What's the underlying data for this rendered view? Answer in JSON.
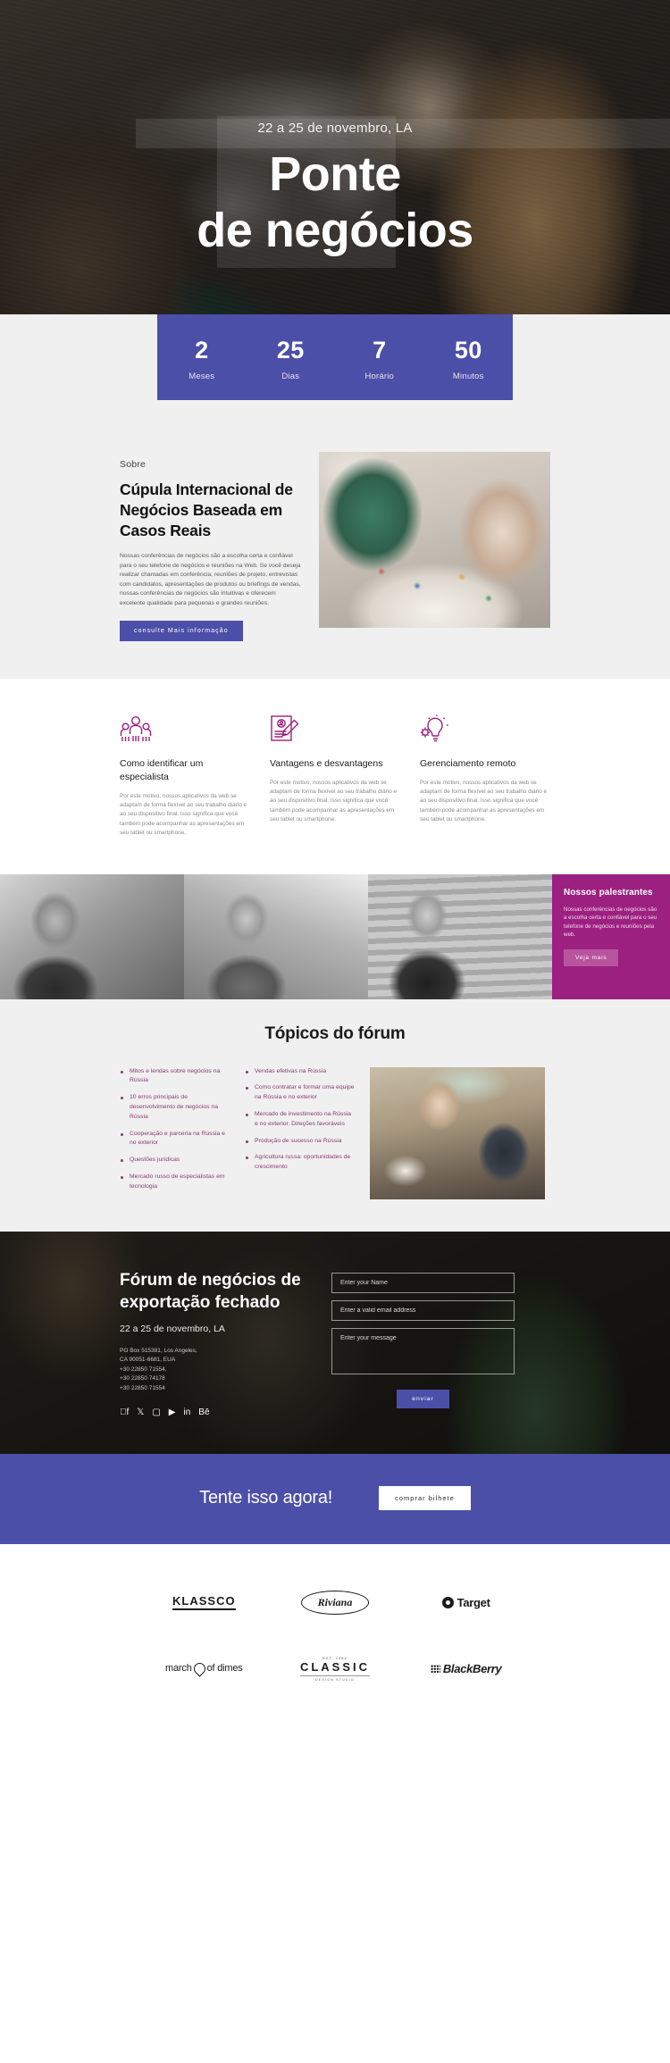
{
  "hero": {
    "date": "22 a 25 de novembro, LA",
    "title_line1": "Ponte",
    "title_line2": "de negócios"
  },
  "countdown": {
    "items": [
      {
        "value": "2",
        "label": "Meses"
      },
      {
        "value": "25",
        "label": "Dias"
      },
      {
        "value": "7",
        "label": "Horário"
      },
      {
        "value": "50",
        "label": "Minutos"
      }
    ]
  },
  "about": {
    "eyebrow": "Sobre",
    "heading": "Cúpula Internacional de Negócios Baseada em Casos Reais",
    "paragraph": "Nossas conferências de negócios são a escolha certa e confiável para o seu telefone de negócios e reuniões na Web. Se você deseja realizar chamadas em conferência, reuniões de projeto, entrevistas com candidatos, apresentações de produtos ou briefings de vendas, nossas conferências de negócios são intuitivas e oferecem excelente qualidade para pequenas e grandes reuniões.",
    "button": "consulte Mais informação"
  },
  "features": [
    {
      "icon": "people-group-icon",
      "title": "Como identificar um especialista",
      "text": "Por este motivo, nossos aplicativos da web se adaptam de forma flexível ao seu trabalho diário e ao seu dispositivo final. Isso significa que você também pode acompanhar as apresentações em seu tablet ou smartphone."
    },
    {
      "icon": "document-pen-icon",
      "title": "Vantagens e desvantagens",
      "text": "Por este motivo, nossos aplicativos da web se adaptam de forma flexível ao seu trabalho diário e ao seu dispositivo final. Isso significa que você também pode acompanhar as apresentações em seu tablet ou smartphone."
    },
    {
      "icon": "lightbulb-gear-icon",
      "title": "Gerenciamento remoto",
      "text": "Por este motivo, nossos aplicativos da web se adaptam de forma flexível ao seu trabalho diário e ao seu dispositivo final. Isso significa que você também pode acompanhar as apresentações em seu tablet ou smartphone."
    }
  ],
  "speakers": {
    "title": "Nossos palestrantes",
    "text": "Nossas conferências de negócios são a escolha certa e confiável para o seu telefone de negócios e reuniões pela web.",
    "button": "Veja mais"
  },
  "topics": {
    "heading": "Tópicos do fórum",
    "column1": [
      "Mitos e lendas sobre negócios na Rússia",
      "10 erros principais de desenvolvimento de negócios na Rússia",
      "Cooperação e parceria na Rússia e no exterior",
      "Questões jurídicas",
      "Mercado russo de especialistas em tecnologia"
    ],
    "column2": [
      "Vendas efetivas na Rússia",
      "Como contratar e formar uma equipe na Rússia e no exterior",
      "Mercado de investimento na Rússia e no exterior. Direções favoráveis",
      "Produção de sucesso na Rússia",
      "Agricultura russa: oportunidades de crescimento"
    ]
  },
  "contact": {
    "heading": "Fórum de negócios de exportação fechado",
    "date": "22 a 25 de novembro, LA",
    "address": "PO Box 515381, Los Angeles,\nCA 90051-6681, EUA\n+30 22850 71554,\n+30 22850 74178\n+30 22850 71554",
    "socials": [
      "facebook-icon",
      "twitter-icon",
      "instagram-icon",
      "youtube-icon",
      "linkedin-icon",
      "behance-icon"
    ],
    "form": {
      "name_placeholder": "Enter your Name",
      "email_placeholder": "Enter a valid email address",
      "message_placeholder": "Enter your message",
      "submit": "enviar"
    }
  },
  "cta": {
    "title": "Tente isso agora!",
    "button": "comprar bilhete"
  },
  "logos": [
    {
      "name": "klassco-logo",
      "text": "KLASSCO"
    },
    {
      "name": "riviana-logo",
      "text": "Riviana"
    },
    {
      "name": "target-logo",
      "text": "Target"
    },
    {
      "name": "march-of-dimes-logo",
      "text_a": "march",
      "text_b": "of dimes"
    },
    {
      "name": "classic-logo",
      "top": "EST. 1984",
      "main": "CLASSIC",
      "sub": "DESIGN STUDIO"
    },
    {
      "name": "blackberry-logo",
      "text": "BlackBerry"
    }
  ],
  "colors": {
    "indigo": "#4c4fa8",
    "magenta": "#9c2080",
    "topic_text": "#8a3a72",
    "page_grey": "#f0f0f0"
  }
}
